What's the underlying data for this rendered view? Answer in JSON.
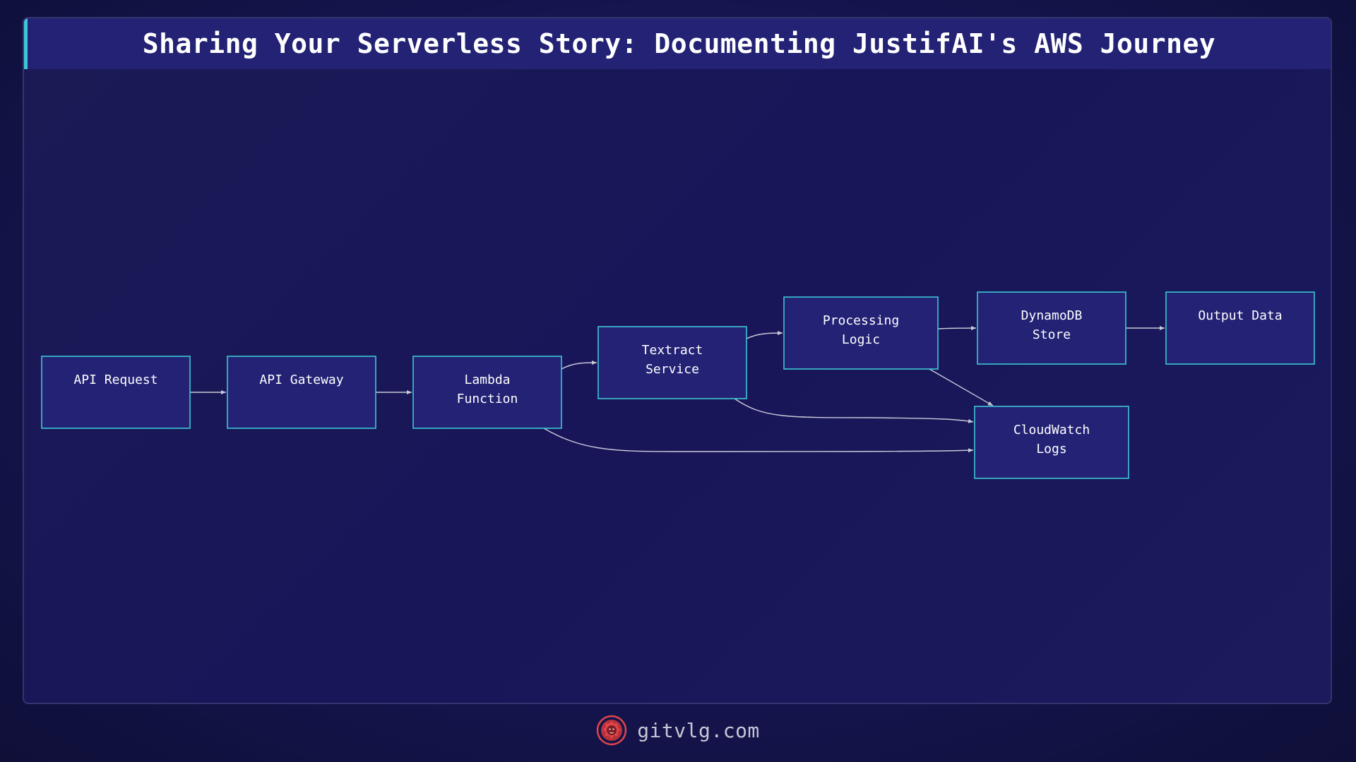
{
  "title": "Sharing Your Serverless Story: Documenting JustifAI's AWS Journey",
  "colors": {
    "node_fill": "#232275",
    "node_border": "#3ec6d6",
    "edge": "#c9c9d9",
    "title_accent": "#3ec6d6",
    "logo": "#e0454b"
  },
  "nodes": [
    {
      "id": "api-request",
      "lines": [
        "API Request"
      ]
    },
    {
      "id": "api-gateway",
      "lines": [
        "API Gateway"
      ]
    },
    {
      "id": "lambda-function",
      "lines": [
        "Lambda",
        "Function"
      ]
    },
    {
      "id": "textract-service",
      "lines": [
        "Textract",
        "Service"
      ]
    },
    {
      "id": "processing-logic",
      "lines": [
        "Processing",
        "Logic"
      ]
    },
    {
      "id": "dynamodb-store",
      "lines": [
        "DynamoDB",
        "Store"
      ]
    },
    {
      "id": "output-data",
      "lines": [
        "Output Data"
      ]
    },
    {
      "id": "cloudwatch-logs",
      "lines": [
        "CloudWatch",
        "Logs"
      ]
    }
  ],
  "edges": [
    {
      "from": "api-request",
      "to": "api-gateway"
    },
    {
      "from": "api-gateway",
      "to": "lambda-function"
    },
    {
      "from": "lambda-function",
      "to": "textract-service"
    },
    {
      "from": "textract-service",
      "to": "processing-logic"
    },
    {
      "from": "processing-logic",
      "to": "dynamodb-store"
    },
    {
      "from": "dynamodb-store",
      "to": "output-data"
    },
    {
      "from": "processing-logic",
      "to": "cloudwatch-logs"
    },
    {
      "from": "textract-service",
      "to": "cloudwatch-logs"
    },
    {
      "from": "lambda-function",
      "to": "cloudwatch-logs"
    }
  ],
  "footer": {
    "logo_icon": "lion-logo-icon",
    "text": "gitvlg.com"
  }
}
